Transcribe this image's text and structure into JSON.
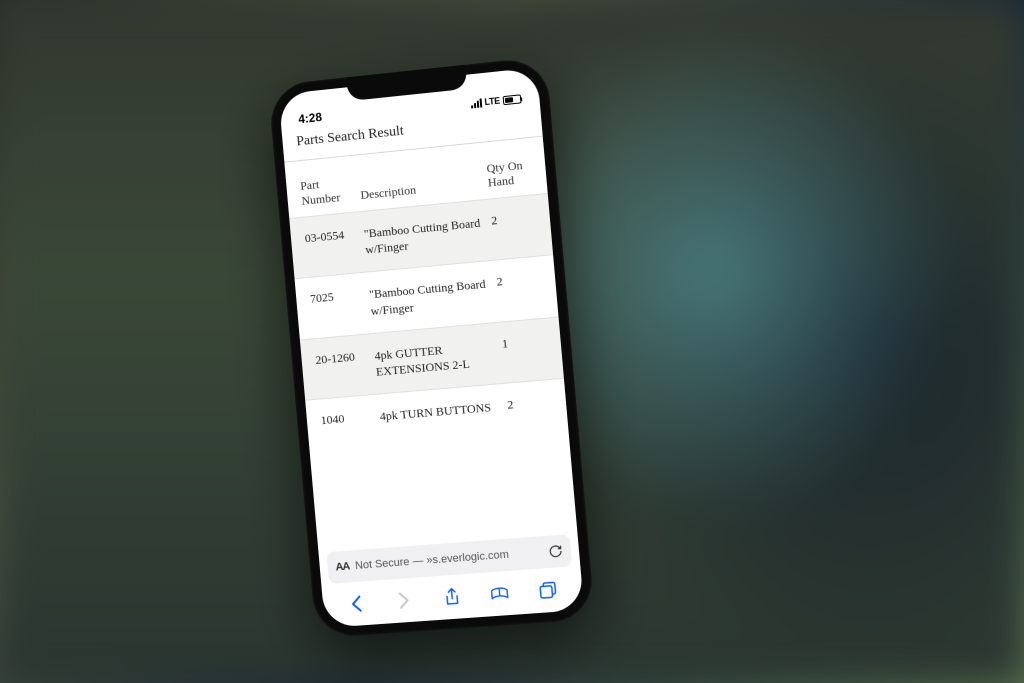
{
  "status": {
    "time": "4:28",
    "network": "LTE"
  },
  "page": {
    "title": "Parts Search Result"
  },
  "table": {
    "headers": {
      "part_number": "Part Number",
      "description": "Description",
      "qty_on_hand": "Qty On Hand"
    },
    "rows": [
      {
        "part_number": "03-0554",
        "description": "\"Bamboo Cutting Board w/Finger",
        "qty": "2"
      },
      {
        "part_number": "7025",
        "description": "\"Bamboo Cutting Board w/Finger",
        "qty": "2"
      },
      {
        "part_number": "20-1260",
        "description": "4pk GUTTER EXTENSIONS 2-L",
        "qty": "1"
      },
      {
        "part_number": "1040",
        "description": "4pk TURN BUTTONS",
        "qty": "2"
      }
    ]
  },
  "browser": {
    "aa_label": "AA",
    "security": "Not Secure",
    "url_display": "»s.everlogic.com"
  }
}
